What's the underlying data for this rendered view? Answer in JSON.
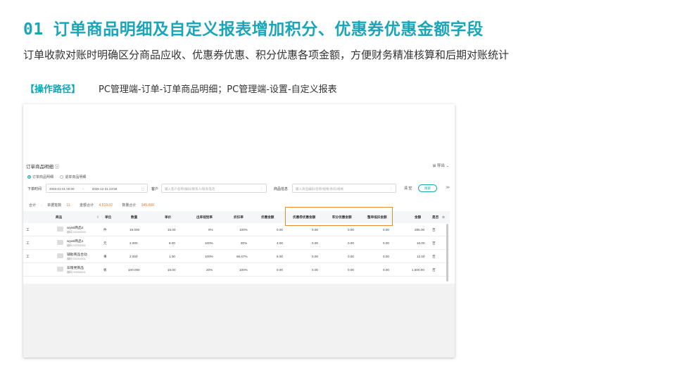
{
  "slide": {
    "number": "01",
    "title": "订单商品明细及自定义报表增加积分、优惠券优惠金额字段",
    "subtitle": "订单收款对账时明确区分商品应收、优惠券优惠、积分优惠各项金额，方便财务精准核算和后期对账统计",
    "path_label": "【操作路径】",
    "path_text": "PC管理端-订单-订单商品明细；PC管理端-设置-自定义报表"
  },
  "app": {
    "title": "订单商品明细 ⓘ",
    "export": "⊞ 导出 ⌄",
    "radios": [
      {
        "label": "订单商品明细",
        "selected": true
      },
      {
        "label": "退单商品明细",
        "selected": false
      }
    ],
    "filters": {
      "date_label": "下单时间",
      "date_start": "2026-01-01 00:00",
      "date_sep": "~",
      "date_end": "2026-12-31 23:59",
      "customer_label": "客户",
      "customer_placeholder": "输入客户名称/编码/联系人/联系电话",
      "product_label": "商品信息",
      "product_placeholder": "输入商品编码/名称/规格/条码/规格",
      "reset": "清 空",
      "search": "搜索",
      "expand": "≫"
    },
    "summary": {
      "total": "合计",
      "rows_label": "单据笔数",
      "rows_value": "11",
      "amount_label": "金额合计",
      "amount_value": "4,519.02",
      "qty_label": "数量合计",
      "qty_value": "345.000"
    },
    "headers": [
      "商品",
      "单位",
      "数量",
      "单价",
      "出库视觉率",
      "折扣率",
      "优惠金额",
      "优惠券优惠金额",
      "积分优惠金额",
      "整单抵扣金额",
      "金额",
      "是否"
    ],
    "rows": [
      {
        "left": "工",
        "name": "wyatt商品2",
        "code": "编码 01002003",
        "unit": "件",
        "qty": "19.000",
        "price": "15.00",
        "rate": "0%",
        "discount": "100%",
        "promo": "0.00",
        "coupon": "0.00",
        "points": "0.00",
        "deduct": "0.00",
        "amount": "285.00",
        "flag": "否"
      },
      {
        "left": "工",
        "name": "wyatt商品1",
        "code": "编码 01002002",
        "unit": "元",
        "qty": "2.000",
        "price": "8.00",
        "rate": "100%",
        "discount": "80%",
        "promo": "4.00",
        "coupon": "0.00",
        "points": "0.00",
        "deduct": "0.00",
        "amount": "16.00",
        "flag": "否"
      },
      {
        "left": "工",
        "name": "辅助商品合动",
        "code": "编码 01001501",
        "unit": "事",
        "qty": "2.000",
        "price": "1.00",
        "rate": "100%",
        "discount": "66.67%",
        "promo": "6.00",
        "coupon": "0.00",
        "points": "0.00",
        "deduct": "0.00",
        "amount": "12.00",
        "flag": "否"
      },
      {
        "left": "",
        "name": "非赠党商品",
        "code": "编码 33000001",
        "unit": "板",
        "qty": "100.000",
        "price": "15.00",
        "rate": "20%",
        "discount": "100%",
        "promo": "0.00",
        "coupon": "0.00",
        "points": "0.00",
        "deduct": "0.00",
        "amount": "1,500.00",
        "flag": "否"
      }
    ]
  }
}
